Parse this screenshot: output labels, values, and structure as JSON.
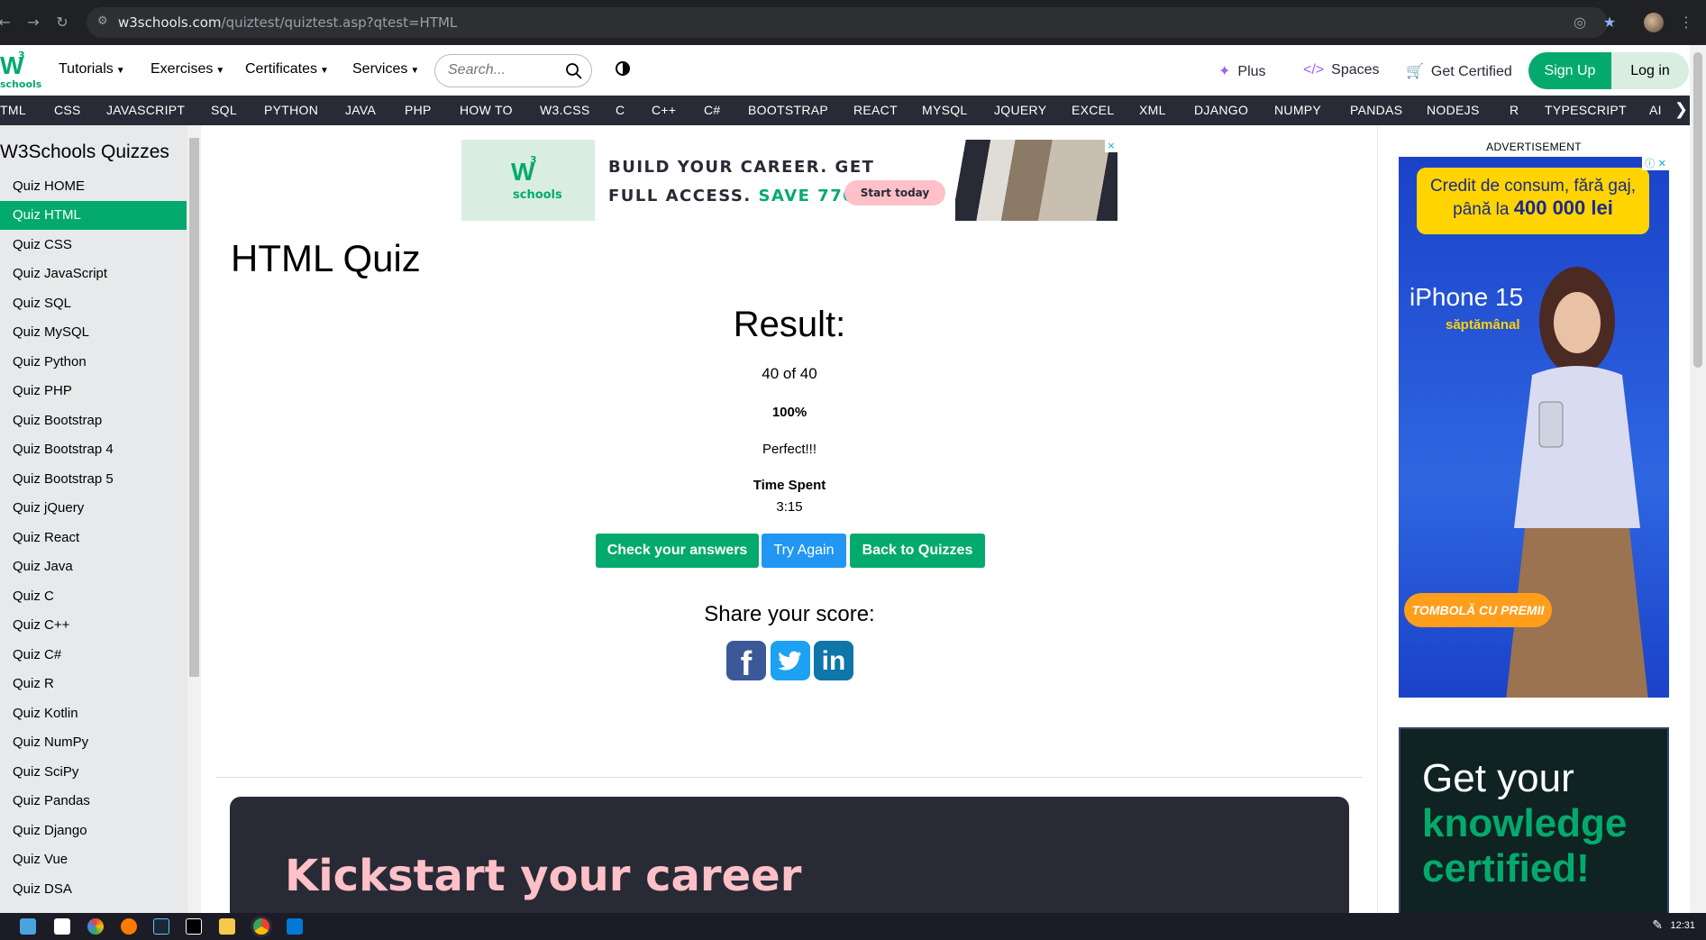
{
  "browser": {
    "url_host": "w3schools.com",
    "url_path": "/quiztest/quiztest.asp?qtest=HTML"
  },
  "header": {
    "logo_text": "W",
    "logo_sup": "3",
    "logo_sub": "schools",
    "menu": [
      {
        "label": "Tutorials"
      },
      {
        "label": "Exercises"
      },
      {
        "label": "Certificates"
      },
      {
        "label": "Services"
      }
    ],
    "search_placeholder": "Search...",
    "right_menu": [
      {
        "label": "Plus",
        "icon": "sparkle-icon"
      },
      {
        "label": "Spaces",
        "icon": "code-icon"
      },
      {
        "label": "Get Certified",
        "icon": "cart-icon"
      }
    ],
    "signup_label": "Sign Up",
    "login_label": "Log in"
  },
  "topics": [
    "TML",
    "CSS",
    "JAVASCRIPT",
    "SQL",
    "PYTHON",
    "JAVA",
    "PHP",
    "HOW TO",
    "W3.CSS",
    "C",
    "C++",
    "C#",
    "BOOTSTRAP",
    "REACT",
    "MYSQL",
    "JQUERY",
    "EXCEL",
    "XML",
    "DJANGO",
    "NUMPY",
    "PANDAS",
    "NODEJS",
    "R",
    "TYPESCRIPT",
    "AI"
  ],
  "sidebar": {
    "title": "W3Schools Quizzes",
    "items": [
      "Quiz HOME",
      "Quiz HTML",
      "Quiz CSS",
      "Quiz JavaScript",
      "Quiz SQL",
      "Quiz MySQL",
      "Quiz Python",
      "Quiz PHP",
      "Quiz Bootstrap",
      "Quiz Bootstrap 4",
      "Quiz Bootstrap 5",
      "Quiz jQuery",
      "Quiz React",
      "Quiz Java",
      "Quiz C",
      "Quiz C++",
      "Quiz C#",
      "Quiz R",
      "Quiz Kotlin",
      "Quiz NumPy",
      "Quiz SciPy",
      "Quiz Pandas",
      "Quiz Django",
      "Quiz Vue",
      "Quiz DSA"
    ],
    "active_index": 1
  },
  "ad_top": {
    "logo_text": "W",
    "logo_sup": "3",
    "logo_sub": "schools",
    "line1": "BUILD YOUR CAREER. GET",
    "line2": "FULL ACCESS.",
    "save": "SAVE 770$",
    "cta": "Start today",
    "close": "×"
  },
  "main": {
    "title": "HTML Quiz",
    "result_heading": "Result:",
    "score": "40 of 40",
    "percent": "100%",
    "verdict": "Perfect!!!",
    "time_label": "Time Spent",
    "time_value": "3:15",
    "buttons": {
      "check": "Check your answers",
      "try": "Try Again",
      "back": "Back to Quizzes"
    },
    "share_heading": "Share your score:",
    "career_heading": "Kickstart your career"
  },
  "right_ads": {
    "label": "ADVERTISEMENT",
    "bank_line1": "Credit de consum, fără gaj,",
    "bank_line2_prefix": "până la ",
    "bank_line2_bold": "400 000 lei",
    "phone": "iPhone 15",
    "week": "săptămânal",
    "tombola": "TOMBOLĂ CU PREMII",
    "cert_l1": "Get your",
    "cert_l2": "knowledge",
    "cert_l3": "certified!"
  },
  "taskbar": {
    "clock": "12:31"
  },
  "colors": {
    "brand_green": "#04aa6d",
    "topic_bar": "#282a35",
    "try_again_blue": "#2196f3"
  }
}
